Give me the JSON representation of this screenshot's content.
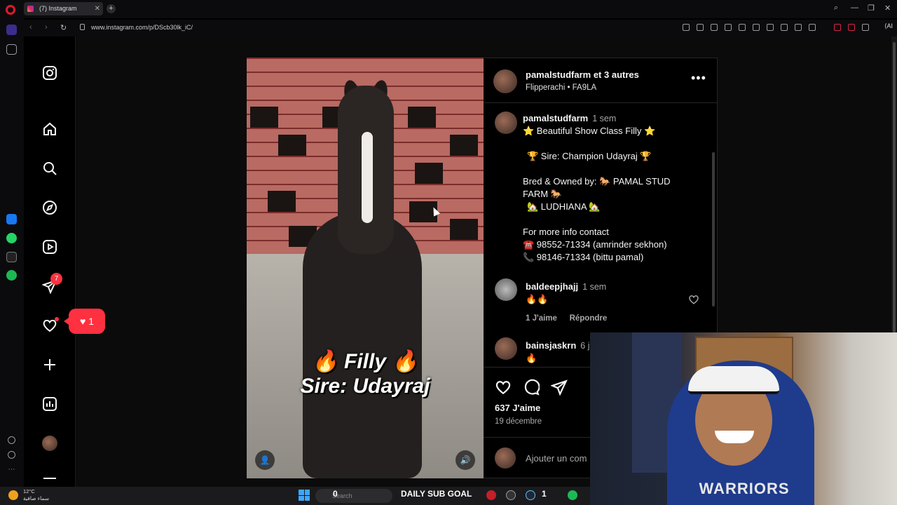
{
  "browser": {
    "tab_title": "(7) Instagram",
    "url": "www.instagram.com/p/DScb30lk_iC/",
    "ai_label": "AI",
    "icons": [
      "opera-icon",
      "instagram-tab-icon",
      "close-icon",
      "plus-icon",
      "search-icon",
      "minimize-icon",
      "maximize-icon",
      "window-close-icon",
      "back-icon",
      "forward-icon",
      "reload-icon",
      "lock-icon"
    ]
  },
  "instagram": {
    "sidebar": {
      "items": [
        {
          "icon": "instagram-logo-icon"
        },
        {
          "icon": "home-icon"
        },
        {
          "icon": "search-icon"
        },
        {
          "icon": "explore-icon"
        },
        {
          "icon": "reels-icon"
        },
        {
          "icon": "messages-icon",
          "badge": "7"
        },
        {
          "icon": "notifications-icon"
        },
        {
          "icon": "create-icon"
        },
        {
          "icon": "dashboard-icon"
        },
        {
          "icon": "profile-avatar"
        },
        {
          "icon": "more-menu-icon"
        }
      ]
    },
    "notification_popup": {
      "count": "1"
    },
    "post": {
      "media_caption_line1": "🔥 Filly 🔥",
      "media_caption_line2": "Sire: Udayraj",
      "owner": "pamalstudfarm",
      "owner_suffix": "et 3 autres",
      "audio": "Flipperachi • FA9LA",
      "caption": {
        "user": "pamalstudfarm",
        "time": "1 sem",
        "lines": [
          "⭐ Beautiful Show Class Filly ⭐",
          "🏆 Sire: Champion Udayraj 🏆",
          "Bred & Owned by: 🐎 PAMAL STUD",
          "FARM 🐎",
          "🏡 LUDHIANA 🏡",
          "For more info contact",
          "☎️ 98552-71334 (amrinder sekhon)",
          "📞 98146-71334 (bittu pamal)"
        ]
      },
      "comments": [
        {
          "user": "baldeepjhajj",
          "time": "1 sem",
          "text": "🔥🔥",
          "likes": "1 J'aime",
          "reply": "Répondre"
        },
        {
          "user": "bainsjaskrn",
          "time": "6 j",
          "text": "🔥"
        }
      ],
      "likes": "637 J'aime",
      "date": "19 décembre",
      "add_comment_placeholder": "Ajouter un com"
    }
  },
  "webcam": {
    "shirt_text": "WARRIORS"
  },
  "taskbar": {
    "temperature": "12°C",
    "weather_text": "سماء صافية",
    "search_placeholder": "Search",
    "sub_count": "0",
    "sub_goal_label": "DAILY SUB GOAL",
    "sub_total": "1"
  },
  "colors": {
    "accent": "#ff3040",
    "opera_red": "#e0182d",
    "background": "#000000"
  }
}
